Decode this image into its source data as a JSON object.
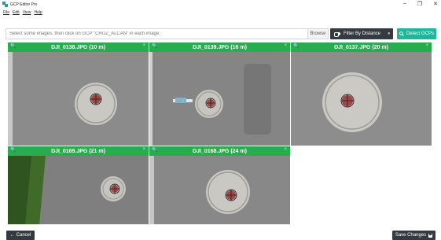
{
  "window": {
    "title": "GCP Editor Pro",
    "controls": {
      "minimize": "–",
      "maximize": "❐",
      "close": "✕"
    }
  },
  "menu": {
    "items": [
      "File",
      "Edit",
      "View",
      "Help"
    ]
  },
  "toolbar": {
    "instruction": "Select some images, then click on GCP \"CRUZ_ALCAN\" in each image.",
    "browse_label": "Browse",
    "filter_label": "Filter By Distance",
    "filter_caret": "▾",
    "detect_label": "Detect GCPs"
  },
  "images": [
    {
      "title": "DJI_0138.JPG (10 m)",
      "zoom_icon": "🔍",
      "close_icon": "×"
    },
    {
      "title": "DJI_0139.JPG (16 m)",
      "zoom_icon": "🔍",
      "close_icon": "×"
    },
    {
      "title": "DJI_0137.JPG (20 m)",
      "zoom_icon": "🔍",
      "close_icon": "×"
    },
    {
      "title": "DJI_0169.JPG (21 m)",
      "zoom_icon": "🔍",
      "close_icon": "×"
    },
    {
      "title": "DJI_0168.JPG (24 m)",
      "zoom_icon": "🔍",
      "close_icon": "×"
    }
  ],
  "footer": {
    "cancel_label": "Cancel",
    "cancel_arrow": "←",
    "save_label": "Save Changes"
  },
  "colors": {
    "tile_header": "#27ad4d",
    "dark_button": "#343a40",
    "detect_button": "#21b59b"
  }
}
